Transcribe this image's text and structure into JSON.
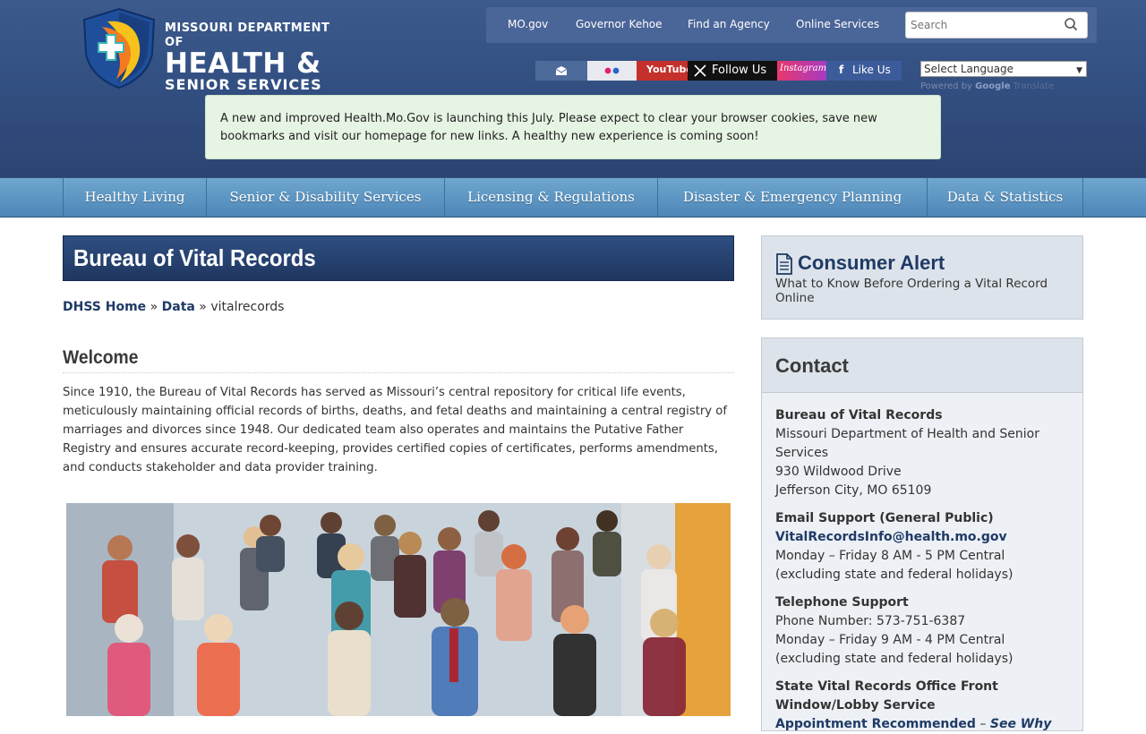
{
  "logo": {
    "line1": "MISSOURI DEPARTMENT OF",
    "line2": "HEALTH &",
    "line3": "SENIOR SERVICES",
    "colors": {
      "shield_blue": "#1f4f9a",
      "shield_orange": "#f47b20",
      "shield_yellow": "#f6c21b",
      "shield_teal": "#3bb6b0"
    }
  },
  "topnav": {
    "links": [
      "MO.gov",
      "Governor Kehoe",
      "Find an Agency",
      "Online Services"
    ],
    "search_placeholder": "Search"
  },
  "social": {
    "youtube": "YouTube",
    "x": "Follow Us",
    "instagram": "Instagram",
    "facebook": "Like Us"
  },
  "translate": {
    "select_label": "Select Language",
    "powered_by": "Powered by",
    "google": "Google",
    "translate": "Translate"
  },
  "notice": "A new and improved Health.Mo.Gov is launching this July. Please expect to clear your browser cookies, save new bookmarks and visit our homepage for new links. A healthy new experience is coming soon!",
  "mainnav": [
    "Healthy Living",
    "Senior & Disability Services",
    "Licensing & Regulations",
    "Disaster & Emergency Planning",
    "Data & Statistics"
  ],
  "page": {
    "title": "Bureau of Vital Records",
    "breadcrumb": {
      "home": "DHSS Home",
      "sep1": " » ",
      "data": "Data",
      "sep2": " » ",
      "current": "vitalrecords"
    },
    "welcome": "Welcome",
    "intro": "Since 1910, the Bureau of Vital Records has served as Missouri’s central repository for critical life events, meticulously maintaining official records of births, deaths, and fetal deaths and maintaining a central registry of marriages and divorces since 1948. Our dedicated team also operates and maintains the Putative Father Registry and ensures accurate record-keeping, provides certified copies of certificates, performs amendments, and conducts stakeholder and data provider training."
  },
  "sidebar": {
    "alert_title": "Consumer Alert",
    "alert_sub": "What to Know Before Ordering a Vital Record Online",
    "contact_title": "Contact",
    "office_name": "Bureau of Vital Records",
    "office_dept": "Missouri Department of Health and Senior Services",
    "office_street": "930 Wildwood Drive",
    "office_city": "Jefferson City, MO 65109",
    "email_head": "Email Support (General Public)",
    "email": "VitalRecordsInfo@health.mo.gov",
    "email_hours": "Monday – Friday 8 AM - 5 PM Central",
    "email_note": "(excluding state and federal holidays)",
    "phone_head": "Telephone Support",
    "phone": "Phone Number: 573-751-6387",
    "phone_hours": "Monday – Friday 9 AM - 4 PM Central",
    "phone_note": "(excluding state and federal holidays)",
    "lobby_head": "State Vital Records Office Front Window/Lobby Service",
    "lobby_appt": "Appointment Recommended",
    "lobby_dash": " – ",
    "lobby_why": "See Why"
  }
}
